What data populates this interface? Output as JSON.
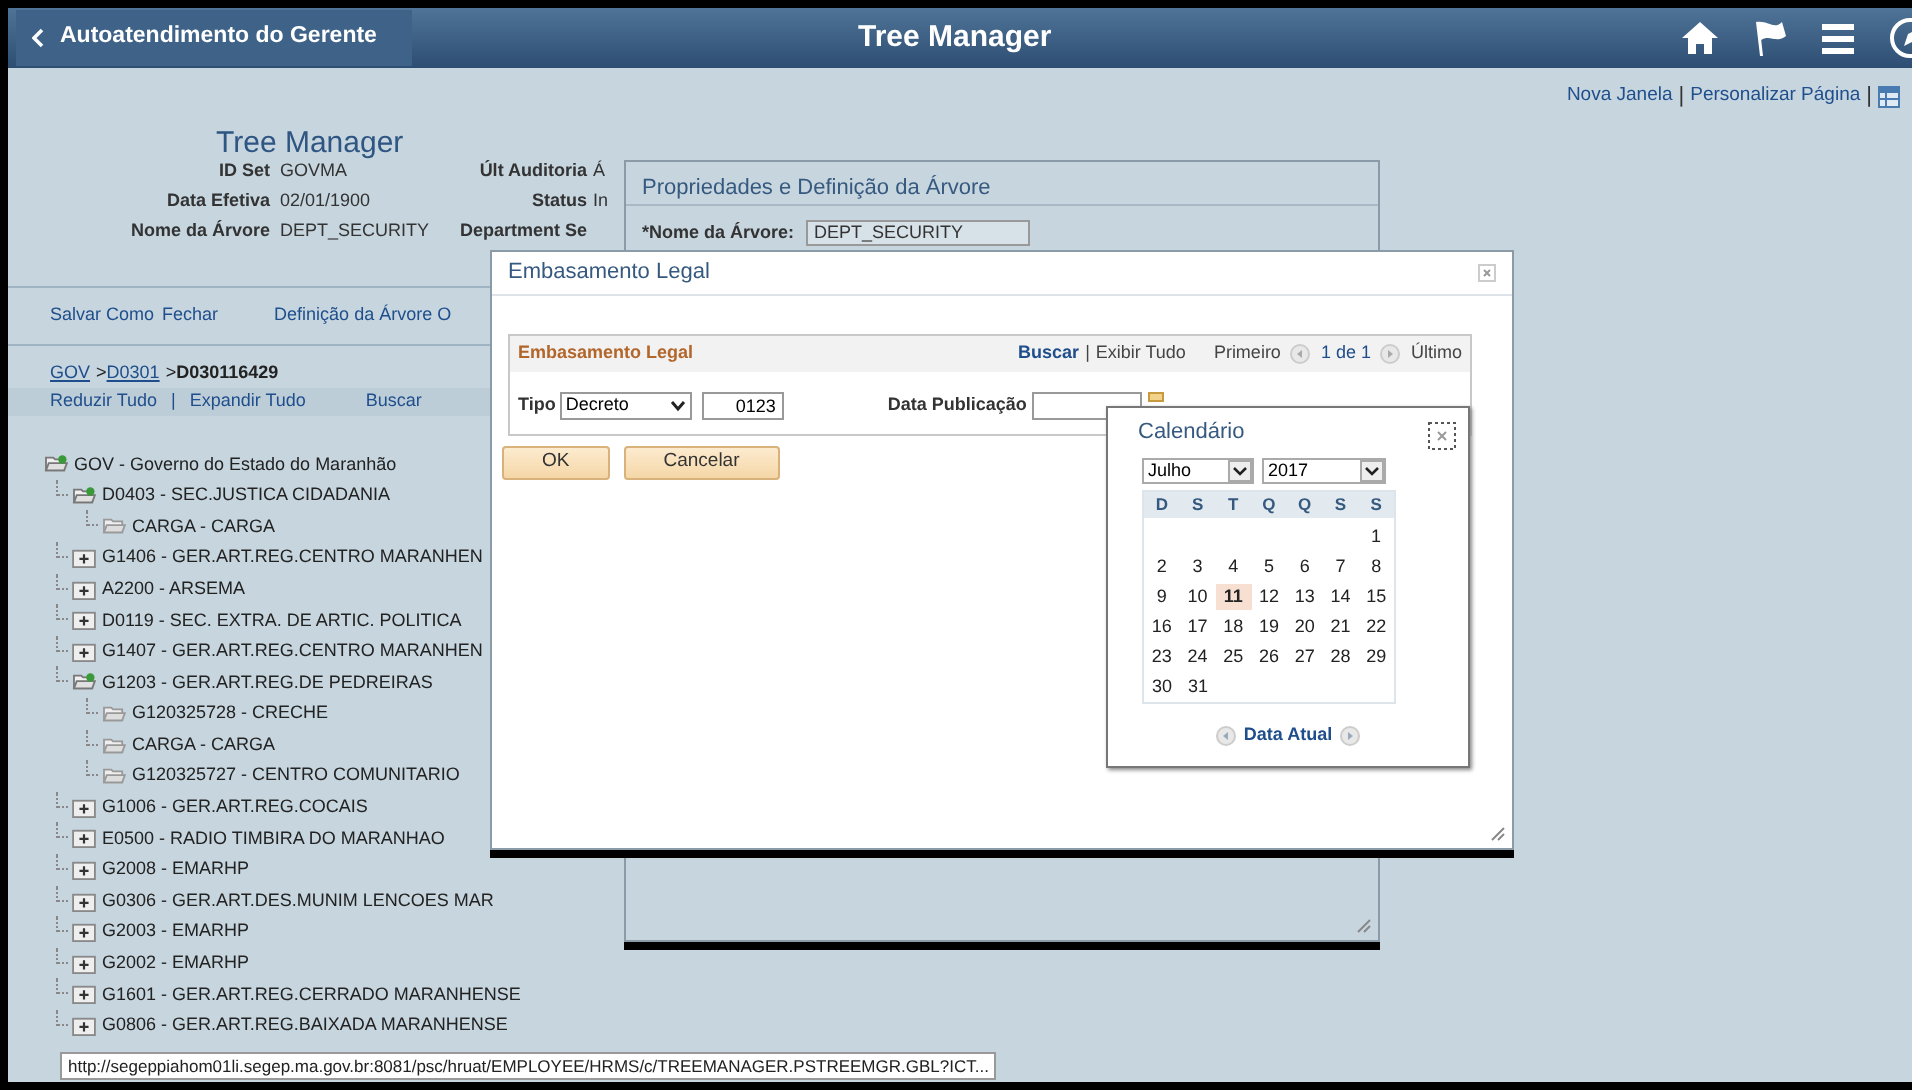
{
  "header": {
    "back_label": "Autoatendimento do Gerente",
    "title": "Tree Manager"
  },
  "page_links": {
    "items": [
      "Nova Janela",
      "Personalizar Página"
    ],
    "separator": "|"
  },
  "tree_manager": {
    "title": "Tree Manager",
    "fields": [
      {
        "label": "ID Set",
        "value": "GOVMA"
      },
      {
        "label": "Data Efetiva",
        "value": "02/01/1900"
      },
      {
        "label": "Nome da Árvore",
        "value": "DEPT_SECURITY"
      }
    ],
    "fields_right": [
      {
        "label": "Últ Auditoria",
        "value": "Á"
      },
      {
        "label": "Status",
        "value": "In"
      },
      {
        "label": "Department Se"
      }
    ],
    "actions": [
      "Salvar Como",
      "Fechar"
    ],
    "definition_link": "Definição da Árvore O",
    "breadcrumb": [
      {
        "label": "GOV",
        "link": true
      },
      {
        "prefix": ">",
        "label": "D0301",
        "link": true
      },
      {
        "prefix": ">",
        "label": "D030116429",
        "link": false
      }
    ],
    "tree_tools": {
      "items": [
        "Reduzir Tudo",
        "Expandir Tudo"
      ],
      "separator": "|"
    },
    "search_link": "Buscar",
    "tree": [
      {
        "kind": "folder",
        "label": "GOV - Governo do Estado do Maranhão",
        "expanded": true,
        "children": [
          {
            "kind": "folder",
            "label": "D0403 - SEC.JUSTICA CIDADANIA",
            "expanded": true,
            "children": [
              {
                "kind": "leaf",
                "label": "CARGA - CARGA"
              }
            ]
          },
          {
            "kind": "folder",
            "label": "G1406 - GER.ART.REG.CENTRO MARANHEN",
            "expanded": false
          },
          {
            "kind": "folder",
            "label": "A2200 - ARSEMA",
            "expanded": false
          },
          {
            "kind": "folder",
            "label": "D0119 - SEC. EXTRA. DE ARTIC. POLITICA",
            "expanded": false
          },
          {
            "kind": "folder",
            "label": "G1407 - GER.ART.REG.CENTRO MARANHEN",
            "expanded": false
          },
          {
            "kind": "folder",
            "label": "G1203 - GER.ART.REG.DE PEDREIRAS",
            "expanded": true,
            "children": [
              {
                "kind": "leaf",
                "label": "G120325728 - CRECHE"
              },
              {
                "kind": "leaf",
                "label": "CARGA - CARGA"
              },
              {
                "kind": "leaf",
                "label": "G120325727 - CENTRO COMUNITARIO"
              }
            ]
          },
          {
            "kind": "folder",
            "label": "G1006 - GER.ART.REG.COCAIS",
            "expanded": false
          },
          {
            "kind": "folder",
            "label": "E0500 - RADIO TIMBIRA DO MARANHAO",
            "expanded": false
          },
          {
            "kind": "folder",
            "label": "G2008 - EMARHP",
            "expanded": false
          },
          {
            "kind": "folder",
            "label": "G0306 - GER.ART.DES.MUNIM LENCOES MAR",
            "expanded": false
          },
          {
            "kind": "folder",
            "label": "G2003 - EMARHP",
            "expanded": false
          },
          {
            "kind": "folder",
            "label": "G2002 - EMARHP",
            "expanded": false
          },
          {
            "kind": "folder",
            "label": "G1601 - GER.ART.REG.CERRADO MARANHENSE",
            "expanded": false
          },
          {
            "kind": "folder",
            "label": "G0806 - GER.ART.REG.BAIXADA MARANHENSE",
            "expanded": false
          }
        ]
      }
    ]
  },
  "properties_window": {
    "title": "Propriedades e Definição da Árvore",
    "field_label": "*Nome da Árvore:",
    "field_value": "DEPT_SECURITY"
  },
  "legal_dialog": {
    "title": "Embasamento Legal",
    "panel_title": "Embasamento Legal",
    "search_link": "Buscar",
    "separator": "|",
    "show_all": "Exibir Tudo",
    "first": "Primeiro",
    "page": "1 de 1",
    "last": "Último",
    "type_label": "Tipo",
    "type_value": "Decreto",
    "number_value": "0123",
    "date_label": "Data Publicação",
    "buttons": [
      "OK",
      "Cancelar"
    ]
  },
  "calendar": {
    "title": "Calendário",
    "month": "Julho",
    "year": "2017",
    "weekdays": [
      "D",
      "S",
      "T",
      "Q",
      "Q",
      "S",
      "S"
    ],
    "weeks": [
      {
        "days": [
          {
            "day": "1",
            "selected": false
          }
        ]
      },
      {
        "days": [
          {
            "day": "2",
            "selected": false
          },
          {
            "day": "3",
            "selected": false
          },
          {
            "day": "4",
            "selected": false
          },
          {
            "day": "5",
            "selected": false
          },
          {
            "day": "6",
            "selected": false
          },
          {
            "day": "7",
            "selected": false
          },
          {
            "day": "8",
            "selected": false
          }
        ]
      },
      {
        "days": [
          {
            "day": "9",
            "selected": false
          },
          {
            "day": "10",
            "selected": false
          },
          {
            "day": "11",
            "selected": true
          },
          {
            "day": "12",
            "selected": false
          },
          {
            "day": "13",
            "selected": false
          },
          {
            "day": "14",
            "selected": false
          },
          {
            "day": "15",
            "selected": false
          }
        ]
      },
      {
        "days": [
          {
            "day": "16",
            "selected": false
          },
          {
            "day": "17",
            "selected": false
          },
          {
            "day": "18",
            "selected": false
          },
          {
            "day": "19",
            "selected": false
          },
          {
            "day": "20",
            "selected": false
          },
          {
            "day": "21",
            "selected": false
          },
          {
            "day": "22",
            "selected": false
          }
        ]
      },
      {
        "days": [
          {
            "day": "23",
            "selected": false
          },
          {
            "day": "24",
            "selected": false
          },
          {
            "day": "25",
            "selected": false
          },
          {
            "day": "26",
            "selected": false
          },
          {
            "day": "27",
            "selected": false
          },
          {
            "day": "28",
            "selected": false
          },
          {
            "day": "29",
            "selected": false
          }
        ]
      },
      {
        "days": [
          {
            "day": "30",
            "selected": false
          },
          {
            "day": "31",
            "selected": false
          }
        ]
      }
    ],
    "today_label": "Data Atual"
  },
  "status_url": "http://segeppiahom01li.segep.ma.gov.br:8081/psc/hruat/EMPLOYEE/HRMS/c/TREEMANAGER.PSTREEMGR.GBL?ICT..."
}
